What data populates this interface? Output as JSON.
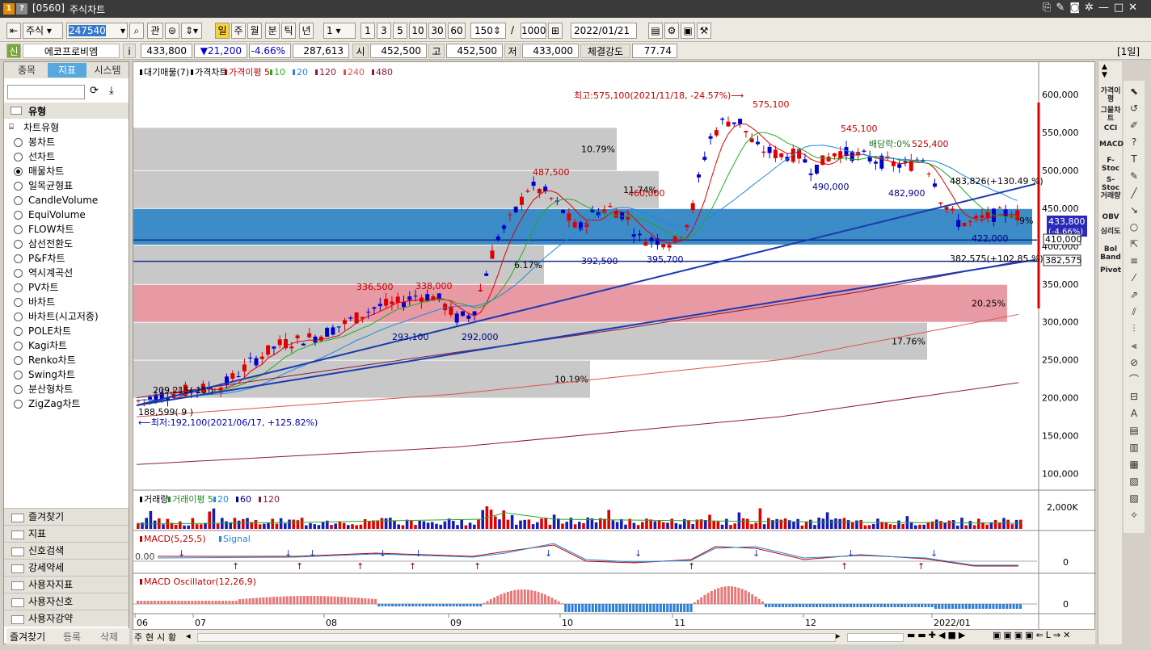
{
  "window": {
    "code": "[0560]",
    "title": "주식차트"
  },
  "toolbar": {
    "market": "주식",
    "code": "247540",
    "search_label": "관",
    "periods": [
      "일",
      "주",
      "월",
      "분",
      "틱",
      "년"
    ],
    "interval": "1",
    "quick": [
      "1",
      "3",
      "5",
      "10",
      "30",
      "60"
    ],
    "count": "150",
    "slash": "/",
    "max": "1000",
    "date": "2022/01/21"
  },
  "quote": {
    "badge": "신",
    "name": "에코프로비엠",
    "info": "i",
    "price": "433,800",
    "change": "▼21,200",
    "rate": "-4.66%",
    "volume": "287,613",
    "open_label": "시",
    "open": "452,500",
    "high_label": "고",
    "high": "452,500",
    "low_label": "저",
    "low": "433,000",
    "strength_label": "체결강도",
    "strength": "77.74",
    "period_tag": "[1일]"
  },
  "sidebar": {
    "tabs": [
      "종목",
      "지표",
      "시스템"
    ],
    "active_tab": 1,
    "section": "유형",
    "group": "차트유형",
    "types": [
      "봉차트",
      "선차트",
      "매물차트",
      "일목균형표",
      "CandleVolume",
      "EquiVolume",
      "FLOW차트",
      "삼선전환도",
      "P&F차트",
      "역시계곡선",
      "PV차트",
      "바차트",
      "바차트(시고저종)",
      "POLE차트",
      "Kagi차트",
      "Renko차트",
      "Swing차트",
      "분산형차트",
      "ZigZag차트"
    ],
    "selected_type": 2,
    "accordion": [
      "즐겨찾기",
      "지표",
      "신호검색",
      "강세약세",
      "사용자지표",
      "사용자신호",
      "사용자강약"
    ],
    "bottom_tabs": [
      "즐겨찾기",
      "등록",
      "삭제"
    ]
  },
  "chart": {
    "legend_main": [
      "대기매물(7)",
      "가격차트",
      "가격이평 5",
      "10",
      "20",
      "120",
      "240",
      "480"
    ],
    "legend_vol": [
      "거래량",
      "거래이평 5",
      "20",
      "60",
      "120"
    ],
    "legend_macd": [
      "MACD(5,25,5)",
      "Signal"
    ],
    "legend_osc": [
      "MACD Oscillator(12,26,9)"
    ],
    "y_axis": [
      "600,000",
      "550,000",
      "500,000",
      "450,000",
      "400,000",
      "350,000",
      "300,000",
      "250,000",
      "200,000",
      "150,000",
      "100,000"
    ],
    "y_values": [
      600000,
      550000,
      500000,
      450000,
      400000,
      350000,
      300000,
      250000,
      200000,
      150000,
      100000
    ],
    "vol_axis": "2,000K",
    "macd_axis": "0",
    "osc_axis": "0",
    "macd_zero": "0.00",
    "x_axis": [
      "06",
      "07",
      "08",
      "09",
      "10",
      "11",
      "12",
      "2022/01"
    ],
    "profile_pct": [
      "10.79%",
      "11.74%",
      "6.17%",
      "20.25%",
      "17.76%",
      "10.19%"
    ],
    "annotations": {
      "high": "최고:575,100(2021/11/18, -24.57%)⟶",
      "low": "⟵최저:192,100(2021/06/17, +125.82%)",
      "dividend": "배당락:0%",
      "trend1": "483,826(+130.49 %)",
      "trend2": "382,575(+102.85 %)",
      "start": "188,599(  9 )",
      "start2": "209,215(  15 )",
      "last": "9%"
    },
    "peaks": [
      "575,100",
      "545,100",
      "525,400",
      "487,500",
      "460,000",
      "490,000",
      "482,900",
      "392,500",
      "395,700",
      "422,000",
      "336,500",
      "338,000",
      "293,100",
      "292,000"
    ],
    "price_tags": {
      "current": "433,800",
      "current_rate": "(-4.66%)",
      "line1": "410,000",
      "line2": "382,575"
    },
    "colors": {
      "up": "#e00000",
      "down": "#0000cc",
      "profile_blue": "#3c8cc8",
      "profile_pink": "#e79aa4",
      "profile_gray": "#c8c8c8"
    }
  },
  "right_indicators": [
    "가격이평",
    "그물차트",
    "CCI",
    "MACD",
    "F-Stoc",
    "S-Stoc",
    "거래량",
    "OBV",
    "심리도",
    "Bol Band",
    "Pivot"
  ],
  "statusbar": {
    "items": [
      "주",
      "현",
      "시",
      "황"
    ]
  }
}
